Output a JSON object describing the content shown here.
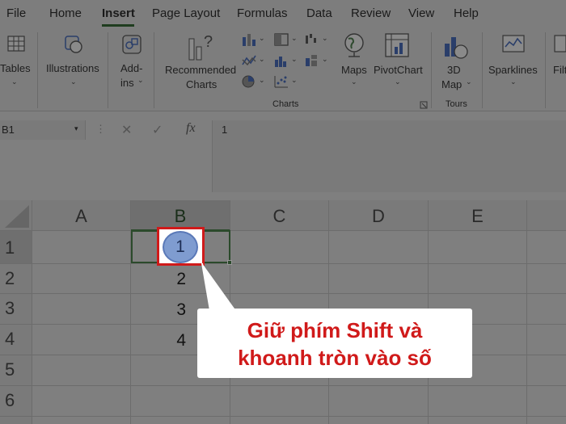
{
  "menu": {
    "items": [
      {
        "key": "file",
        "label": "File"
      },
      {
        "key": "home",
        "label": "Home"
      },
      {
        "key": "insert",
        "label": "Insert"
      },
      {
        "key": "page-layout",
        "label": "Page Layout"
      },
      {
        "key": "formulas",
        "label": "Formulas"
      },
      {
        "key": "data",
        "label": "Data"
      },
      {
        "key": "review",
        "label": "Review"
      },
      {
        "key": "view",
        "label": "View"
      },
      {
        "key": "help",
        "label": "Help"
      }
    ],
    "active": "Insert"
  },
  "ribbon": {
    "tables_label": "Tables",
    "illustrations_label": "Illustrations",
    "addins_label_1": "Add-",
    "addins_label_2": "ins",
    "recommended_charts_label_1": "Recommended",
    "recommended_charts_label_2": "Charts",
    "maps_label": "Maps",
    "pivotchart_label": "PivotChart",
    "map3d_label_1": "3D",
    "map3d_label_2": "Map",
    "sparklines_label": "Sparklines",
    "filters_label": "Filt",
    "charts_group_label": "Charts",
    "tours_group_label": "Tours",
    "dropdown_icon": "chevron-down-icon"
  },
  "formula_bar": {
    "name_box": "B1",
    "formula_value": "1",
    "fx_label": "fx"
  },
  "sheet": {
    "columns": [
      "A",
      "B",
      "C",
      "D",
      "E"
    ],
    "rows": [
      "1",
      "2",
      "3",
      "4",
      "5",
      "6"
    ],
    "selected_column": "B",
    "selected_row": "1",
    "cells": {
      "B1": "1",
      "B2": "2",
      "B3": "3",
      "B4": "4"
    }
  },
  "annotation": {
    "line1": "Giữ phím Shift và",
    "line2": "khoanh tròn vào số",
    "highlight_color": "#d01a1a",
    "circle_color": "#7f9cd0"
  }
}
